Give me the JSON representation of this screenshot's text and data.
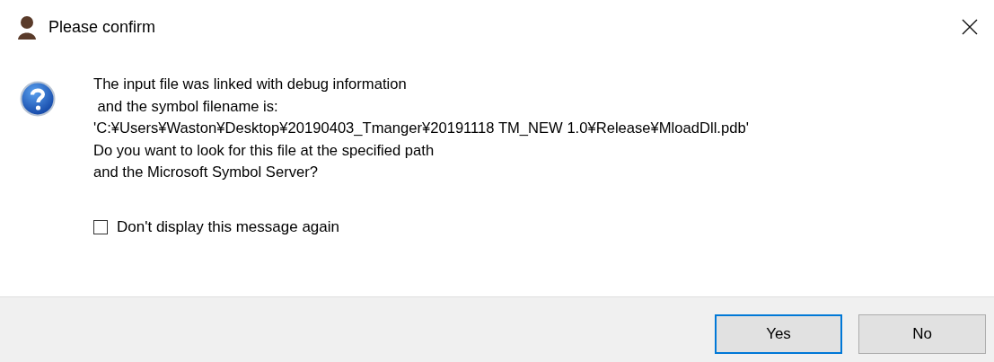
{
  "window": {
    "title": "Please confirm"
  },
  "message": {
    "lines": [
      "The input file was linked with debug information",
      " and the symbol filename is:",
      "'C:¥Users¥Waston¥Desktop¥20190403_Tmanger¥20191118 TM_NEW 1.0¥Release¥MloadDll.pdb'",
      "Do you want to look for this file at the specified path",
      "and the Microsoft Symbol Server?"
    ]
  },
  "checkbox": {
    "label": "Don't display this message again",
    "checked": false
  },
  "buttons": [
    {
      "label": "Yes",
      "selected": true
    },
    {
      "label": "No",
      "selected": false
    }
  ]
}
